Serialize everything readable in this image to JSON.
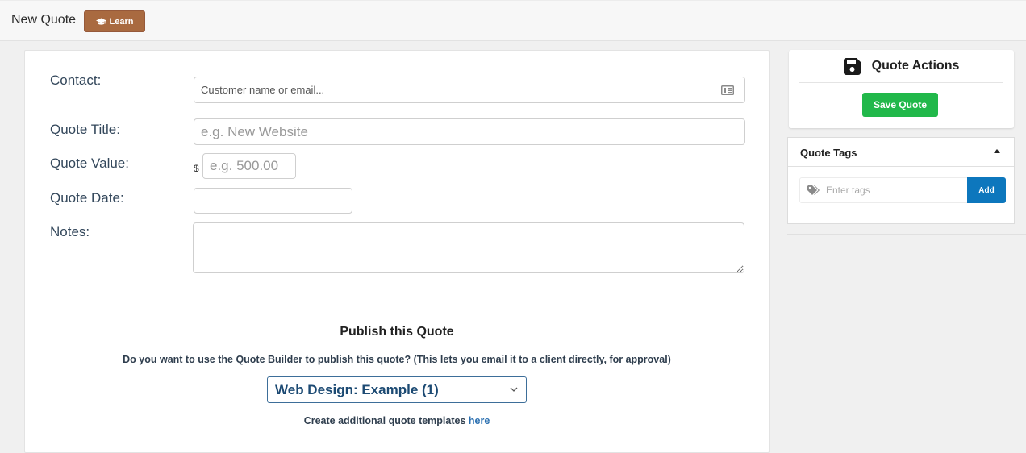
{
  "header": {
    "title": "New Quote",
    "learn_label": "Learn",
    "learn_icon": "graduation-cap-icon",
    "learn_color": "#a96a40"
  },
  "form": {
    "contact": {
      "label": "Contact:",
      "placeholder": "Customer name or email...",
      "value": "",
      "icon": "address-card-icon"
    },
    "title": {
      "label": "Quote Title:",
      "placeholder": "e.g. New Website",
      "value": ""
    },
    "value": {
      "label": "Quote Value:",
      "currency_symbol": "$",
      "placeholder": "e.g. 500.00",
      "value": ""
    },
    "date": {
      "label": "Quote Date:",
      "value": ""
    },
    "notes": {
      "label": "Notes:",
      "value": ""
    }
  },
  "publish": {
    "title": "Publish this Quote",
    "description": "Do you want to use the Quote Builder to publish this quote? (This lets you email it to a client directly, for approval)",
    "template_selected": "Web Design: Example (1)",
    "templates_note": "Create additional quote templates ",
    "templates_link": "here"
  },
  "sidebar": {
    "actions": {
      "title": "Quote Actions",
      "icon": "save-floppy-icon",
      "save_label": "Save Quote",
      "save_color": "#21b84a"
    },
    "tags": {
      "title": "Quote Tags",
      "placeholder": "Enter tags",
      "value": "",
      "add_label": "Add",
      "add_color": "#0d77bd"
    }
  }
}
